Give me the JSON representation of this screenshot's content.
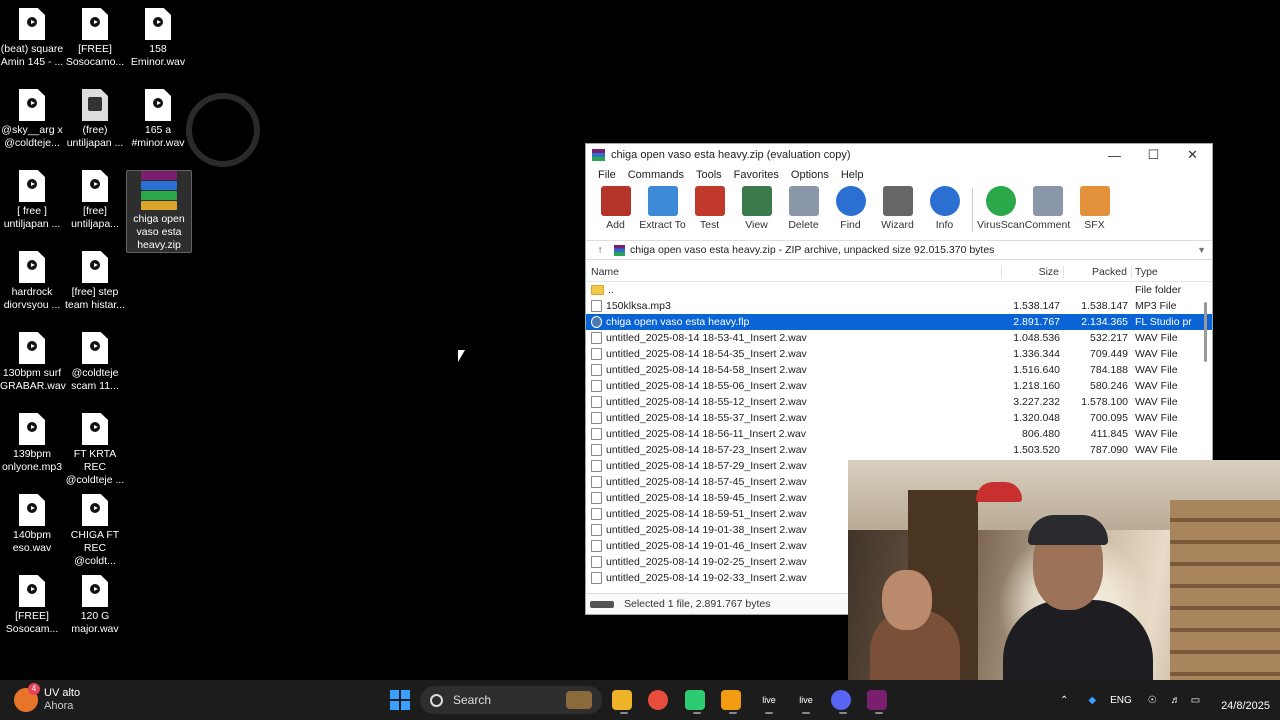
{
  "desktop": {
    "icons": [
      {
        "label": "(beat) square Amin 145 - ...",
        "kind": "audio"
      },
      {
        "label": "[FREE] Sosocamo...",
        "kind": "audio"
      },
      {
        "label": "158 Eminor.wav",
        "kind": "audio"
      },
      {
        "label": "@sky__arg x @coldteje...",
        "kind": "audio"
      },
      {
        "label": "(free) untiljapan ...",
        "kind": "image"
      },
      {
        "label": "165 a #minor.wav",
        "kind": "audio"
      },
      {
        "label": "[ free ] untiljapan ...",
        "kind": "audio"
      },
      {
        "label": "[free] untiljapa...",
        "kind": "audio"
      },
      {
        "label": "chiga open vaso esta heavy.zip",
        "kind": "zip"
      },
      {
        "label": "hardrock diorvsyou ...",
        "kind": "audio"
      },
      {
        "label": "[free] step team  histar...",
        "kind": "audio"
      },
      {
        "label": "130bpm surf GRABAR.wav",
        "kind": "audio"
      },
      {
        "label": "@coldteje scam 11...",
        "kind": "audio"
      },
      {
        "label": "139bpm onlyone.mp3",
        "kind": "audio"
      },
      {
        "label": "FT KRTA REC @coldteje ...",
        "kind": "audio"
      },
      {
        "label": "140bpm eso.wav",
        "kind": "audio"
      },
      {
        "label": "CHIGA FT REC @coldt...",
        "kind": "audio"
      },
      {
        "label": "[FREE] Sosocam...",
        "kind": "audio"
      },
      {
        "label": "120 G major.wav",
        "kind": "audio"
      }
    ]
  },
  "winrar": {
    "title": "chiga open vaso esta heavy.zip (evaluation copy)",
    "window_controls": {
      "minimize": "—",
      "maximize": "☐",
      "close": "✕"
    },
    "menu": [
      "File",
      "Commands",
      "Tools",
      "Favorites",
      "Options",
      "Help"
    ],
    "toolbar": [
      {
        "label": "Add",
        "icon": "add-archive-icon",
        "color": "#b5342a"
      },
      {
        "label": "Extract To",
        "icon": "folder-icon",
        "color": "#3d8ad8"
      },
      {
        "label": "Test",
        "icon": "test-icon",
        "color": "#c0392b"
      },
      {
        "label": "View",
        "icon": "book-icon",
        "color": "#3c7a4c"
      },
      {
        "label": "Delete",
        "icon": "trash-icon",
        "color": "#8a97a8"
      },
      {
        "label": "Find",
        "icon": "magnifier-icon",
        "color": "#2a6fd1"
      },
      {
        "label": "Wizard",
        "icon": "wand-icon",
        "color": "#666666"
      },
      {
        "label": "Info",
        "icon": "info-icon",
        "color": "#2a6fd1"
      },
      {
        "label": "VirusScan",
        "icon": "virus-icon",
        "color": "#2aa84a"
      },
      {
        "label": "Comment",
        "icon": "comment-icon",
        "color": "#8a97a8"
      },
      {
        "label": "SFX",
        "icon": "sfx-box-icon",
        "color": "#e3913a"
      }
    ],
    "path": "chiga open vaso esta heavy.zip - ZIP archive, unpacked size 92.015.370 bytes",
    "columns": {
      "name": "Name",
      "size": "Size",
      "packed": "Packed",
      "type": "Type"
    },
    "files": [
      {
        "name": "..",
        "size": "",
        "packed": "",
        "type": "File folder",
        "kind": "folder"
      },
      {
        "name": "150klksa.mp3",
        "size": "1.538.147",
        "packed": "1.538.147",
        "type": "MP3 File",
        "kind": "file"
      },
      {
        "name": "chiga open vaso esta heavy.flp",
        "size": "2.891.767",
        "packed": "2.134.365",
        "type": "FL Studio pr",
        "kind": "flp",
        "selected": true
      },
      {
        "name": "untitled_2025-08-14 18-53-41_Insert 2.wav",
        "size": "1.048.536",
        "packed": "532.217",
        "type": "WAV File",
        "kind": "file"
      },
      {
        "name": "untitled_2025-08-14 18-54-35_Insert 2.wav",
        "size": "1.336.344",
        "packed": "709.449",
        "type": "WAV File",
        "kind": "file"
      },
      {
        "name": "untitled_2025-08-14 18-54-58_Insert 2.wav",
        "size": "1.516.640",
        "packed": "784.188",
        "type": "WAV File",
        "kind": "file"
      },
      {
        "name": "untitled_2025-08-14 18-55-06_Insert 2.wav",
        "size": "1.218.160",
        "packed": "580.246",
        "type": "WAV File",
        "kind": "file"
      },
      {
        "name": "untitled_2025-08-14 18-55-12_Insert 2.wav",
        "size": "3.227.232",
        "packed": "1.578.100",
        "type": "WAV File",
        "kind": "file"
      },
      {
        "name": "untitled_2025-08-14 18-55-37_Insert 2.wav",
        "size": "1.320.048",
        "packed": "700.095",
        "type": "WAV File",
        "kind": "file"
      },
      {
        "name": "untitled_2025-08-14 18-56-11_Insert 2.wav",
        "size": "806.480",
        "packed": "411.845",
        "type": "WAV File",
        "kind": "file"
      },
      {
        "name": "untitled_2025-08-14 18-57-23_Insert 2.wav",
        "size": "1.503.520",
        "packed": "787.090",
        "type": "WAV File",
        "kind": "file"
      },
      {
        "name": "untitled_2025-08-14 18-57-29_Insert 2.wav",
        "size": "",
        "packed": "",
        "type": "",
        "kind": "file"
      },
      {
        "name": "untitled_2025-08-14 18-57-45_Insert 2.wav",
        "size": "",
        "packed": "",
        "type": "",
        "kind": "file"
      },
      {
        "name": "untitled_2025-08-14 18-59-45_Insert 2.wav",
        "size": "",
        "packed": "",
        "type": "",
        "kind": "file"
      },
      {
        "name": "untitled_2025-08-14 18-59-51_Insert 2.wav",
        "size": "",
        "packed": "",
        "type": "",
        "kind": "file"
      },
      {
        "name": "untitled_2025-08-14 19-01-38_Insert 2.wav",
        "size": "",
        "packed": "",
        "type": "",
        "kind": "file"
      },
      {
        "name": "untitled_2025-08-14 19-01-46_Insert 2.wav",
        "size": "",
        "packed": "",
        "type": "",
        "kind": "file"
      },
      {
        "name": "untitled_2025-08-14 19-02-25_Insert 2.wav",
        "size": "",
        "packed": "",
        "type": "",
        "kind": "file"
      },
      {
        "name": "untitled_2025-08-14 19-02-33_Insert 2.wav",
        "size": "",
        "packed": "",
        "type": "",
        "kind": "file"
      }
    ],
    "status": "Selected 1 file, 2.891.767 bytes"
  },
  "taskbar": {
    "weather": {
      "title": "UV alto",
      "subtitle": "Ahora",
      "badge": "4"
    },
    "search_label": "Search",
    "apps": [
      {
        "name": "file-explorer-icon",
        "label": ""
      },
      {
        "name": "chrome-icon",
        "label": ""
      },
      {
        "name": "app-green-icon",
        "label": ""
      },
      {
        "name": "fl-studio-icon",
        "label": ""
      },
      {
        "name": "live-app-icon-1",
        "label": "live"
      },
      {
        "name": "live-app-icon-2",
        "label": "live"
      },
      {
        "name": "discord-icon",
        "label": ""
      },
      {
        "name": "winrar-taskbar-icon",
        "label": ""
      }
    ],
    "language": "ENG",
    "date": "24/8/2025"
  },
  "colors": {
    "selection": "#0a64d6",
    "taskbar": "#1c1c1c",
    "windows_accent": "#3aa0ff"
  }
}
